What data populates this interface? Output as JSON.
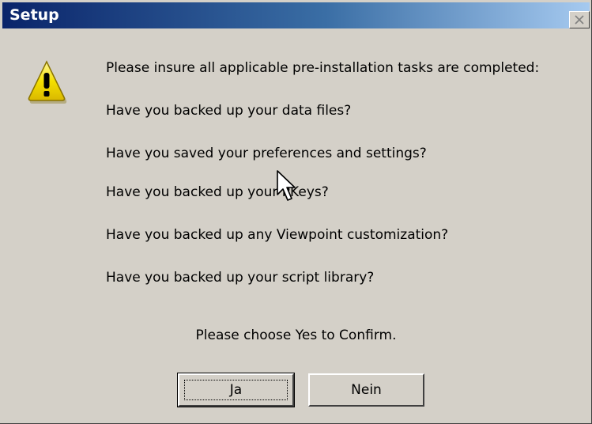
{
  "window": {
    "title": "Setup",
    "close_icon": "close-icon"
  },
  "dialog": {
    "icon": "warning-icon",
    "lines": [
      "Please insure all applicable pre-installation tasks are completed:",
      "Have you backed up your data files?",
      "Have you saved your preferences and settings?",
      "Have you backed up your PKeys?",
      "Have you backed up any Viewpoint customization?",
      "Have you backed up your script library?"
    ],
    "confirm_text": "Please choose Yes to Confirm."
  },
  "buttons": {
    "yes_label": "Ja",
    "no_label": "Nein"
  },
  "colors": {
    "titlebar_start": "#0a246a",
    "titlebar_end": "#a6caf0",
    "dialog_bg": "#d4d0c8",
    "warning_yellow": "#f5e000"
  }
}
